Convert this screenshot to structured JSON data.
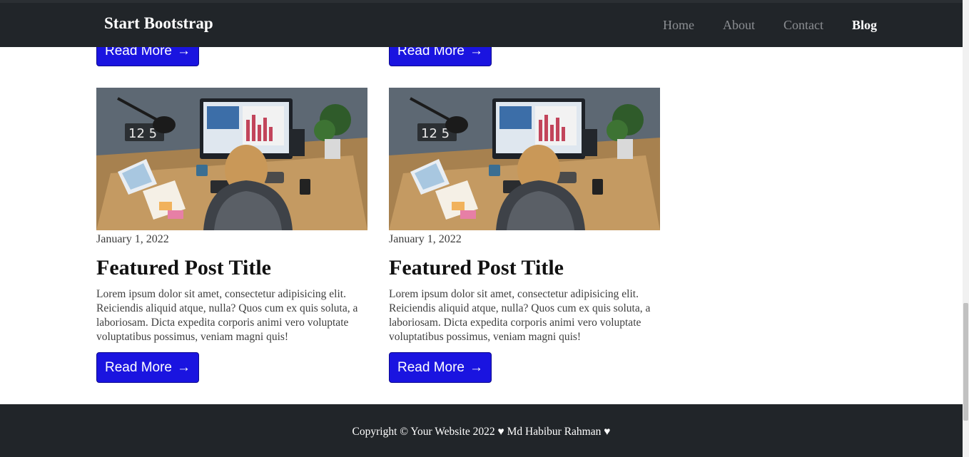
{
  "navbar": {
    "brand": "Start Bootstrap",
    "links": [
      {
        "label": "Home",
        "active": false
      },
      {
        "label": "About",
        "active": false
      },
      {
        "label": "Contact",
        "active": false
      },
      {
        "label": "Blog",
        "active": true
      }
    ]
  },
  "top_buttons": [
    {
      "label": "Read More",
      "arrow": "→"
    },
    {
      "label": "Read More",
      "arrow": "→"
    }
  ],
  "posts": [
    {
      "date": "January 1, 2022",
      "title": "Featured Post Title",
      "text": "Lorem ipsum dolor sit amet, consectetur adipisicing elit. Reiciendis aliquid atque, nulla? Quos cum ex quis soluta, a laboriosam. Dicta expedita corporis animi vero voluptate voluptatibus possimus, veniam magni quis!",
      "button_label": "Read More",
      "button_arrow": "→"
    },
    {
      "date": "January 1, 2022",
      "title": "Featured Post Title",
      "text": "Lorem ipsum dolor sit amet, consectetur adipisicing elit. Reiciendis aliquid atque, nulla? Quos cum ex quis soluta, a laboriosam. Dicta expedita corporis animi vero voluptate voluptatibus possimus, veniam magni quis!",
      "button_label": "Read More",
      "button_arrow": "→"
    }
  ],
  "footer": {
    "text": "Copyright © Your Website 2022 ♥ Md Habibur Rahman ♥"
  },
  "colors": {
    "navbar_bg": "#212529",
    "button_bg": "#1a14e0",
    "footer_bg": "#212529"
  }
}
